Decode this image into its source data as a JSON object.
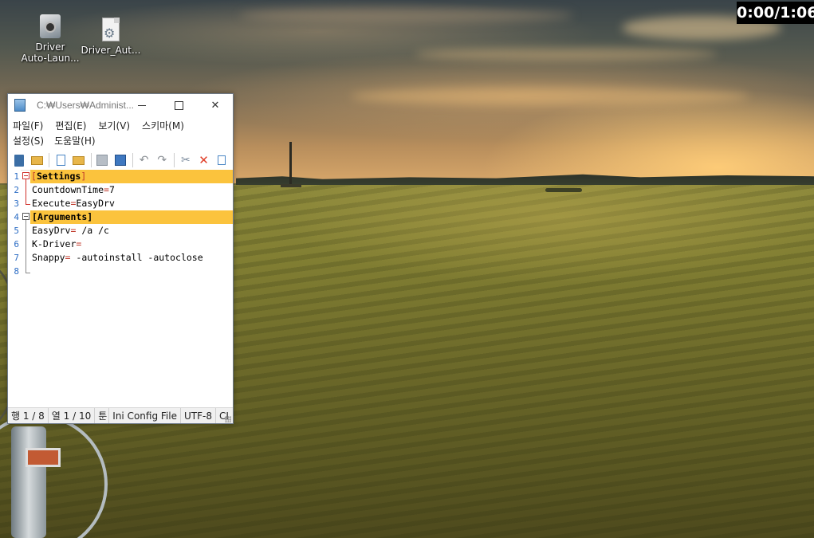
{
  "desktop": {
    "icons": [
      {
        "label_line1": "Driver",
        "label_line2": "Auto-Laun..."
      },
      {
        "label_line1": "Driver_Aut...",
        "label_line2": ""
      }
    ]
  },
  "timer": {
    "text": "0:00/1:06"
  },
  "window": {
    "title": "C:₩Users₩Administ...",
    "menu_row1": [
      "파일(F)",
      "편집(E)",
      "보기(V)",
      "스키마(M)"
    ],
    "menu_row2": [
      "설정(S)",
      "도움말(H)"
    ],
    "toolbar": [
      "book-icon",
      "open-folder-icon",
      "new-file-icon",
      "open-file-icon",
      "save-disabled-icon",
      "save-all-icon",
      "undo-icon",
      "redo-icon",
      "cut-icon",
      "delete-icon",
      "copy-icon"
    ],
    "editor_lines": [
      {
        "num": "1",
        "key": "",
        "eq": "",
        "value": "",
        "section": "Settings"
      },
      {
        "num": "2",
        "key": "CountdownTime",
        "eq": "=",
        "value": "7",
        "section": ""
      },
      {
        "num": "3",
        "key": "Execute",
        "eq": "=",
        "value": "EasyDrv",
        "section": ""
      },
      {
        "num": "4",
        "key": "",
        "eq": "",
        "value": "",
        "section": "Arguments"
      },
      {
        "num": "5",
        "key": "EasyDrv",
        "eq": "=",
        "value": " /a /c",
        "section": ""
      },
      {
        "num": "6",
        "key": "K-Driver",
        "eq": "=",
        "value": "",
        "section": ""
      },
      {
        "num": "7",
        "key": "Snappy",
        "eq": "=",
        "value": " -autoinstall -autoclose",
        "section": ""
      },
      {
        "num": "8",
        "key": "",
        "eq": "",
        "value": "",
        "section": ""
      }
    ],
    "status": {
      "line": "행 1 / 8",
      "col": "열 1 / 10",
      "sel": "툰",
      "filetype": "Ini Config File",
      "encoding": "UTF-8",
      "eol": "CI"
    }
  }
}
